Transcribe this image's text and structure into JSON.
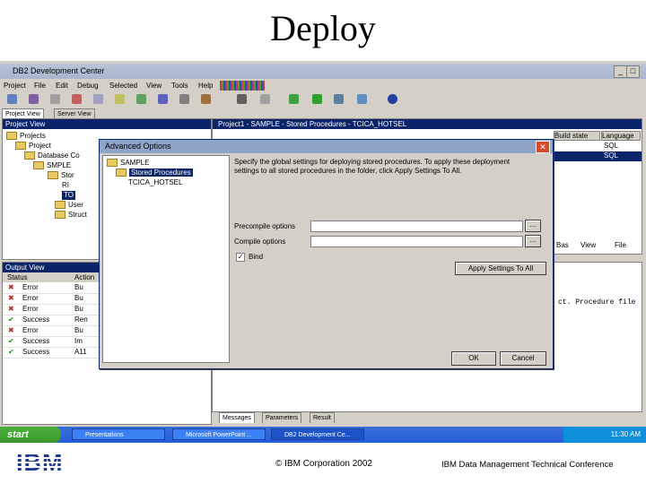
{
  "slide": {
    "title": "Deploy",
    "copyright": "© IBM Corporation 2002",
    "conference": "IBM Data Management Technical Conference",
    "logo_text": "IBM"
  },
  "app": {
    "title": "DB2 Development Center",
    "menu": [
      "Project",
      "File",
      "Edit",
      "Debug",
      "Selected",
      "View",
      "Tools",
      "Help"
    ],
    "tabs": [
      "Project View",
      "Server View"
    ],
    "project_view_header": "Project View",
    "tree": [
      "Projects",
      "Project",
      "Database Co",
      "SMPLE",
      "Stor",
      "RI",
      "TO",
      "User",
      "Struct"
    ],
    "detail_header": "Project1 - SAMPLE - Stored Procedures - TCICA_HOTSEL",
    "detail_cols": [
      "Build state",
      "Language"
    ],
    "detail_vals": [
      "SQL",
      "SQL"
    ],
    "right_toolbar": [
      "Bas",
      "View",
      "File"
    ],
    "output_header": "Output View",
    "output_cols": [
      "Status",
      "Action"
    ],
    "output_rows": [
      {
        "status": "Error",
        "action": "Bu"
      },
      {
        "status": "Error",
        "action": "Bu"
      },
      {
        "status": "Error",
        "action": "Bu"
      },
      {
        "status": "Success",
        "action": "Ren"
      },
      {
        "status": "Error",
        "action": "Bu"
      },
      {
        "status": "Success",
        "action": "Im"
      },
      {
        "status": "Success",
        "action": "A11"
      }
    ],
    "output_right_text": "ct. Procedure file",
    "bottom_tabs": [
      "Messages",
      "Parameters",
      "Result"
    ]
  },
  "dialog": {
    "title": "Advanced Options",
    "tree": [
      "SAMPLE",
      "Stored Procedures",
      "TCICA_HOTSEL"
    ],
    "description": "Specify the global settings for deploying stored procedures. To apply these deployment settings to all stored procedures in the folder, click Apply Settings To All.",
    "fields": [
      {
        "label": "Precompile options",
        "value": ""
      },
      {
        "label": "Compile options",
        "value": ""
      }
    ],
    "browse_label": "...",
    "checkbox_label": "Bind",
    "apply_button": "Apply Settings To All",
    "ok_button": "OK",
    "cancel_button": "Cancel"
  },
  "taskbar": {
    "start": "start",
    "tasks": [
      "Presentations",
      "Microsoft PowerPoint ...",
      "DB2 Development Ce..."
    ],
    "clock": "11:30 AM"
  },
  "colors": {
    "accent": "#0a246a",
    "error": "#cc2222",
    "success": "#228b22"
  }
}
